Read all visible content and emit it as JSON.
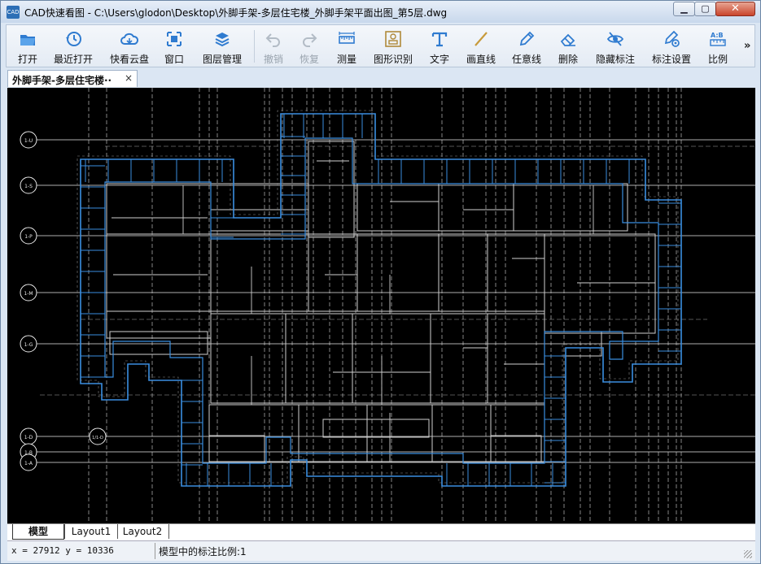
{
  "window": {
    "icon_text": "CAD",
    "title": "CAD快速看图 - C:\\Users\\glodon\\Desktop\\外脚手架-多层住宅楼_外脚手架平面出图_第5层.dwg"
  },
  "toolbar": {
    "items": [
      {
        "label": "打开",
        "icon": "folder-open-icon",
        "enabled": true
      },
      {
        "label": "最近打开",
        "icon": "recent-clock-icon",
        "enabled": true
      },
      {
        "label": "快看云盘",
        "icon": "cloud-drive-icon",
        "enabled": true
      },
      {
        "label": "窗口",
        "icon": "window-zoom-icon",
        "enabled": true
      },
      {
        "label": "图层管理",
        "icon": "layers-icon",
        "enabled": true
      },
      {
        "label": "撤销",
        "icon": "undo-icon",
        "enabled": false
      },
      {
        "label": "恢复",
        "icon": "redo-icon",
        "enabled": false
      },
      {
        "label": "测量",
        "icon": "ruler-icon",
        "enabled": true
      },
      {
        "label": "图形识别",
        "icon": "shape-recognize-icon",
        "enabled": true
      },
      {
        "label": "文字",
        "icon": "text-tool-icon",
        "enabled": true
      },
      {
        "label": "画直线",
        "icon": "line-tool-icon",
        "enabled": true
      },
      {
        "label": "任意线",
        "icon": "freehand-pen-icon",
        "enabled": true
      },
      {
        "label": "删除",
        "icon": "eraser-icon",
        "enabled": true
      },
      {
        "label": "隐藏标注",
        "icon": "hide-eye-icon",
        "enabled": true
      },
      {
        "label": "标注设置",
        "icon": "annotation-settings-icon",
        "enabled": true
      },
      {
        "label": "比例",
        "icon": "scale-ab-icon",
        "enabled": true
      }
    ],
    "more": "»"
  },
  "doc_tab": {
    "label": "外脚手架-多层住宅楼··",
    "close": "×"
  },
  "drawing": {
    "axis_labels": [
      "1-U",
      "1-S",
      "1-P",
      "1-M",
      "1-G",
      "1-D",
      "1-B",
      "1-A"
    ],
    "extra_axis_label": "1/1-D",
    "colors": {
      "background": "#000000",
      "scaffold": "#3a8ee0",
      "walls": "#cfcfcf",
      "axes": "#e8e8e8"
    }
  },
  "layout_tabs": [
    "模型",
    "Layout1",
    "Layout2"
  ],
  "status": {
    "coordinates": "x = 27912  y = 10336",
    "scale_text": "模型中的标注比例:1"
  }
}
